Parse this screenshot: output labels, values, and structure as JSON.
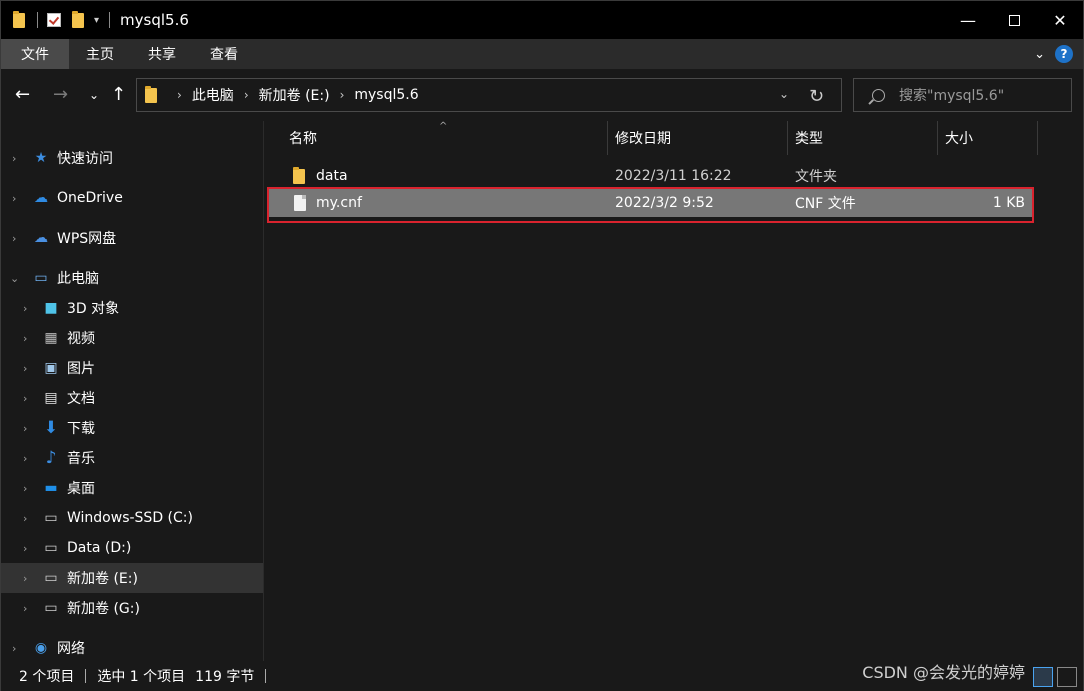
{
  "window": {
    "title": "mysql5.6",
    "controls": {
      "minimize": "—",
      "maximize": "",
      "close": "✕"
    }
  },
  "ribbon": {
    "tabs": [
      "文件",
      "主页",
      "共享",
      "查看"
    ],
    "help": "?"
  },
  "address": {
    "crumbs": [
      "此电脑",
      "新加卷 (E:)",
      "mysql5.6"
    ],
    "search_placeholder": "搜索\"mysql5.6\""
  },
  "sidebar": {
    "items": [
      {
        "label": "快速访问",
        "icon": "star-icon",
        "level": 0
      },
      {
        "label": "OneDrive",
        "icon": "cloud-icon",
        "level": 0
      },
      {
        "label": "WPS网盘",
        "icon": "wps-cloud-icon",
        "level": 0
      },
      {
        "label": "此电脑",
        "icon": "pc-icon",
        "level": 0,
        "expanded": true
      },
      {
        "label": "3D 对象",
        "icon": "cube-icon",
        "level": 1
      },
      {
        "label": "视频",
        "icon": "video-icon",
        "level": 1
      },
      {
        "label": "图片",
        "icon": "picture-icon",
        "level": 1
      },
      {
        "label": "文档",
        "icon": "document-icon",
        "level": 1
      },
      {
        "label": "下载",
        "icon": "download-icon",
        "level": 1
      },
      {
        "label": "音乐",
        "icon": "music-icon",
        "level": 1
      },
      {
        "label": "桌面",
        "icon": "desktop-icon",
        "level": 1
      },
      {
        "label": "Windows-SSD (C:)",
        "icon": "system-drive-icon",
        "level": 1
      },
      {
        "label": "Data (D:)",
        "icon": "drive-icon",
        "level": 1
      },
      {
        "label": "新加卷 (E:)",
        "icon": "drive-icon",
        "level": 1,
        "selected": true
      },
      {
        "label": "新加卷 (G:)",
        "icon": "drive-icon",
        "level": 1
      },
      {
        "label": "网络",
        "icon": "network-icon",
        "level": 0
      }
    ]
  },
  "table": {
    "columns": [
      "名称",
      "修改日期",
      "类型",
      "大小"
    ],
    "rows": [
      {
        "name": "data",
        "date": "2022/3/11 16:22",
        "type": "文件夹",
        "size": "",
        "icon": "folder-icon"
      },
      {
        "name": "my.cnf",
        "date": "2022/3/2 9:52",
        "type": "CNF 文件",
        "size": "1 KB",
        "icon": "file-icon",
        "selected": true
      }
    ]
  },
  "status": {
    "count": "2 个项目",
    "selection": "选中 1 个项目",
    "size": "119 字节"
  },
  "watermark": "CSDN @会发光的婷婷",
  "colors": {
    "background": "#191919",
    "titlebar": "#000000",
    "selection": "#777777",
    "highlight_border": "#d9232e",
    "accent": "#1e72c8"
  }
}
